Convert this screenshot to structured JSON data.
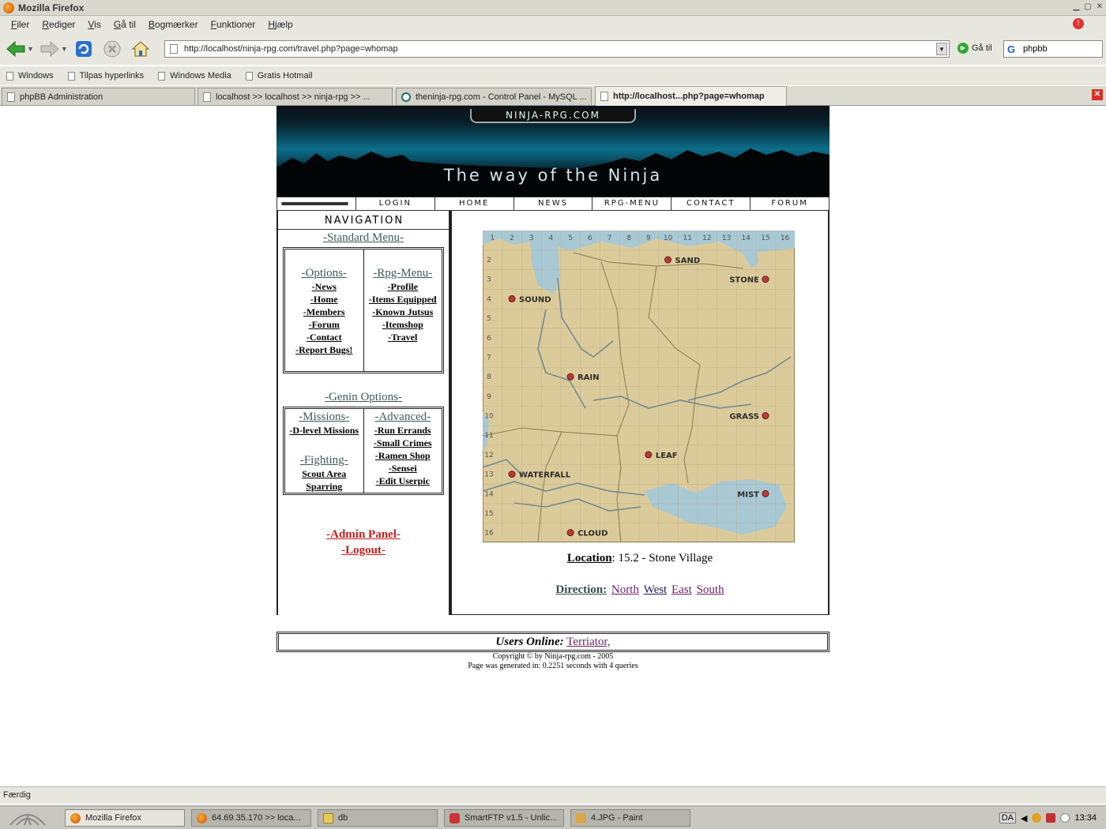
{
  "window": {
    "title": "Mozilla Firefox"
  },
  "menu": [
    "Filer",
    "Rediger",
    "Vis",
    "Gå til",
    "Bogmærker",
    "Funktioner",
    "Hjælp"
  ],
  "menu_accel": [
    "F",
    "R",
    "V",
    "G",
    "B",
    "F",
    "H"
  ],
  "toolbar": {
    "url": "http://localhost/ninja-rpg.com/travel.php?page=whomap",
    "go_label": "Gå til",
    "search_value": "phpbb"
  },
  "bookmarks": [
    "Windows",
    "Tilpas hyperlinks",
    "Windows Media",
    "Gratis Hotmail"
  ],
  "tabs": [
    {
      "label": "phpBB Administration"
    },
    {
      "label": "localhost >> localhost >> ninja-rpg >> ..."
    },
    {
      "label": "theninja-rpg.com - Control Panel - MySQL ..."
    },
    {
      "label": "http://localhost...php?page=whomap"
    }
  ],
  "site": {
    "logo_text": "NINJA-RPG.COM",
    "tagline": "The way of the Ninja",
    "topnav": [
      "LOGIN",
      "HOME",
      "NEWS",
      "RPG-MENU",
      "CONTACT",
      "FORUM"
    ],
    "nav_heading": "NAVIGATION",
    "standard_menu_title": "-Standard Menu-",
    "options_title": "-Options-",
    "options_items": [
      "News",
      "Home",
      "Members",
      "Forum",
      "Contact",
      "Report Bugs!"
    ],
    "rpg_title": "-Rpg-Menu-",
    "rpg_items": [
      "Profile",
      "Items Equipped",
      "Known Jutsus",
      "Itemshop",
      "Travel"
    ],
    "genin_title": "-Genin Options-",
    "missions_title": "-Missions-",
    "missions_items": [
      "D-level Missions"
    ],
    "fighting_title": "-Fighting-",
    "fighting_items": [
      "Scout Area",
      "Sparring"
    ],
    "advanced_title": "-Advanced-",
    "advanced_items": [
      "Run Errands",
      "Small Crimes",
      "Ramen Shop",
      "Sensei",
      "Edit Userpic"
    ],
    "admin_label": "-Admin Panel-",
    "logout_label": "-Logout-"
  },
  "map": {
    "columns": [
      "1",
      "2",
      "3",
      "4",
      "5",
      "6",
      "7",
      "8",
      "9",
      "10",
      "11",
      "12",
      "13",
      "14",
      "15",
      "16"
    ],
    "rows": [
      "2",
      "3",
      "4",
      "5",
      "6",
      "7",
      "8",
      "9",
      "10",
      "11",
      "12",
      "13",
      "14",
      "15",
      "16"
    ],
    "villages": [
      {
        "name": "SAND",
        "col": 10,
        "row": 2
      },
      {
        "name": "STONE",
        "col": 15,
        "row": 3
      },
      {
        "name": "SOUND",
        "col": 2,
        "row": 4
      },
      {
        "name": "RAIN",
        "col": 5,
        "row": 8
      },
      {
        "name": "GRASS",
        "col": 15,
        "row": 10
      },
      {
        "name": "LEAF",
        "col": 9,
        "row": 12
      },
      {
        "name": "WATERFALL",
        "col": 2,
        "row": 13
      },
      {
        "name": "MIST",
        "col": 15,
        "row": 14
      },
      {
        "name": "CLOUD",
        "col": 5,
        "row": 16
      }
    ]
  },
  "location": {
    "label": "Location",
    "value": ": 15.2 - Stone Village"
  },
  "direction": {
    "label": "Direction:",
    "links": [
      "North",
      "West",
      "East",
      "South"
    ]
  },
  "users_online": {
    "label": "Users Online:",
    "users": "Terriator,"
  },
  "footer": {
    "copyright": "Copyright © by Ninja-rpg.com - 2005",
    "generated": "Page was generated in: 0.2251 seconds with 4 queries"
  },
  "status": "Færdig",
  "taskbar": {
    "items": [
      "Mozilla Firefox",
      "64.69.35.170 >> loca...",
      "db",
      "SmartFTP v1.5 - Unlic...",
      "4.JPG - Paint"
    ],
    "lang": "DA",
    "clock": "13:34"
  },
  "colors": {
    "chrome": "#e8e7df",
    "link_visited": "#6a1f6a",
    "admin_red": "#c02020",
    "heading_teal": "#3e5a5a",
    "map_paper": "#dccb9a",
    "map_water": "#a8c8d4"
  }
}
